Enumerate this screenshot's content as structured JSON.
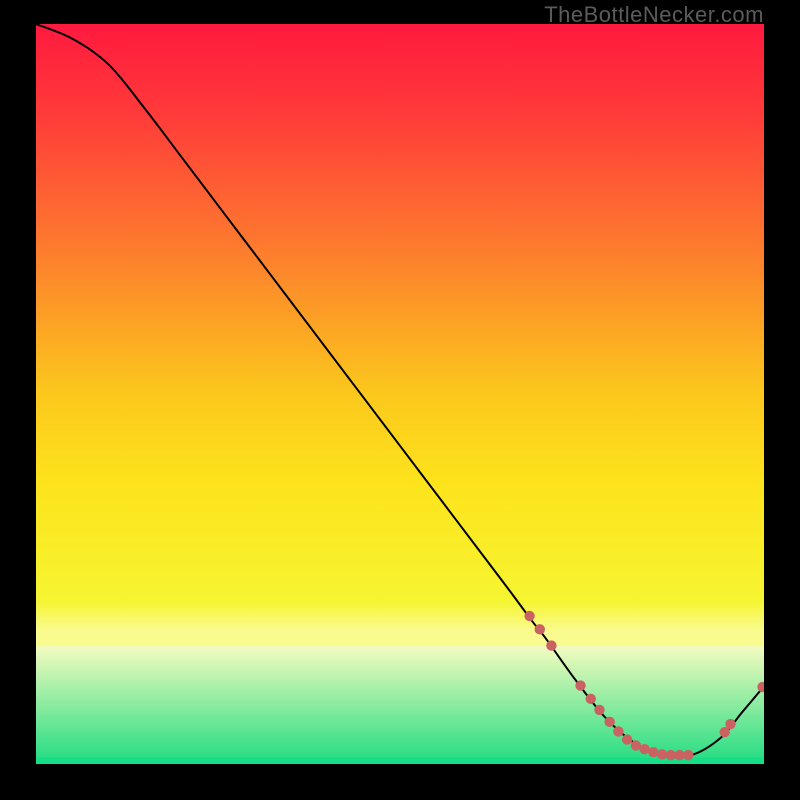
{
  "watermark": "TheBottleNecker.com",
  "colors": {
    "curve": "#000000",
    "marker": "#c96261",
    "background_black": "#000000"
  },
  "gradient": {
    "main_stops": [
      {
        "offset": 0.0,
        "color": "#ff1a3e"
      },
      {
        "offset": 0.12,
        "color": "#ff3a3a"
      },
      {
        "offset": 0.3,
        "color": "#fd7a2e"
      },
      {
        "offset": 0.5,
        "color": "#fbc81c"
      },
      {
        "offset": 0.62,
        "color": "#fde31c"
      },
      {
        "offset": 0.78,
        "color": "#f6f531"
      },
      {
        "offset": 0.82,
        "color": "#f9fb8f"
      }
    ]
  },
  "chart_data": {
    "type": "line",
    "title": "",
    "xlabel": "",
    "ylabel": "",
    "xlim": [
      0,
      100
    ],
    "ylim": [
      0,
      100
    ],
    "curve": {
      "name": "bottleneck-curve",
      "x": [
        0,
        5,
        10,
        15,
        20,
        25,
        30,
        35,
        40,
        45,
        50,
        55,
        60,
        65,
        68,
        70,
        74,
        78,
        82,
        86,
        90,
        94,
        97,
        100
      ],
      "y": [
        100,
        98,
        94.5,
        88.5,
        82,
        75.5,
        69,
        62.5,
        56,
        49.5,
        43,
        36.5,
        30,
        23.5,
        19.5,
        17,
        11.5,
        6.5,
        3,
        1.2,
        1.2,
        3.5,
        7,
        10.5
      ]
    },
    "markers": {
      "name": "highlighted-points",
      "x": [
        67.8,
        69.2,
        70.8,
        74.8,
        76.2,
        77.4,
        78.8,
        80.0,
        81.2,
        82.4,
        83.6,
        84.8,
        86.0,
        87.2,
        88.4,
        89.6,
        94.6,
        95.4,
        99.8
      ],
      "y": [
        20.0,
        18.2,
        16.0,
        10.6,
        8.8,
        7.3,
        5.7,
        4.4,
        3.3,
        2.5,
        2.0,
        1.6,
        1.3,
        1.2,
        1.2,
        1.2,
        4.3,
        5.4,
        10.4
      ]
    }
  }
}
